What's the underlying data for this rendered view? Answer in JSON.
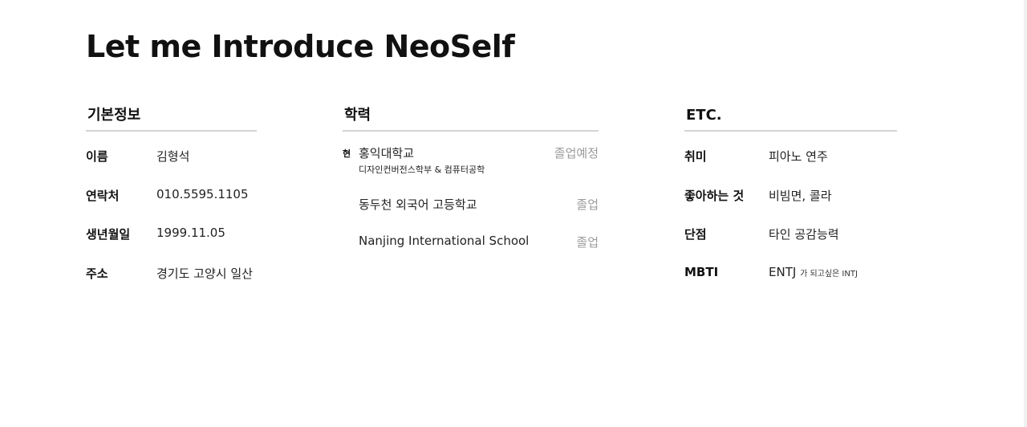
{
  "title": "Let me Introduce NeoSelf",
  "basic": {
    "heading": "기본정보",
    "rows": [
      {
        "label": "이름",
        "value": "김형석"
      },
      {
        "label": "연락처",
        "value": "010.5595.1105"
      },
      {
        "label": "생년월일",
        "value": "1999.11.05"
      },
      {
        "label": "주소",
        "value": "경기도 고양시 일산"
      }
    ]
  },
  "education": {
    "heading": "학력",
    "items": [
      {
        "marker": "현",
        "name": "홍익대학교",
        "major": "디자인컨버전스학부 & 컴퓨터공학",
        "status": "졸업예정"
      },
      {
        "marker": "",
        "name": "동두천 외국어 고등학교",
        "major": "",
        "status": "졸업"
      },
      {
        "marker": "",
        "name": "Nanjing International School",
        "major": "",
        "status": "졸업"
      }
    ]
  },
  "etc": {
    "heading": "ETC.",
    "rows": [
      {
        "label": "취미",
        "value": "피아노 연주",
        "note": ""
      },
      {
        "label": "좋아하는 것",
        "value": "비빔면, 콜라",
        "note": ""
      },
      {
        "label": "단점",
        "value": "타인 공감능력",
        "note": ""
      },
      {
        "label": "MBTI",
        "value": "ENTJ",
        "note": "가 되고싶은 INTJ"
      }
    ]
  }
}
